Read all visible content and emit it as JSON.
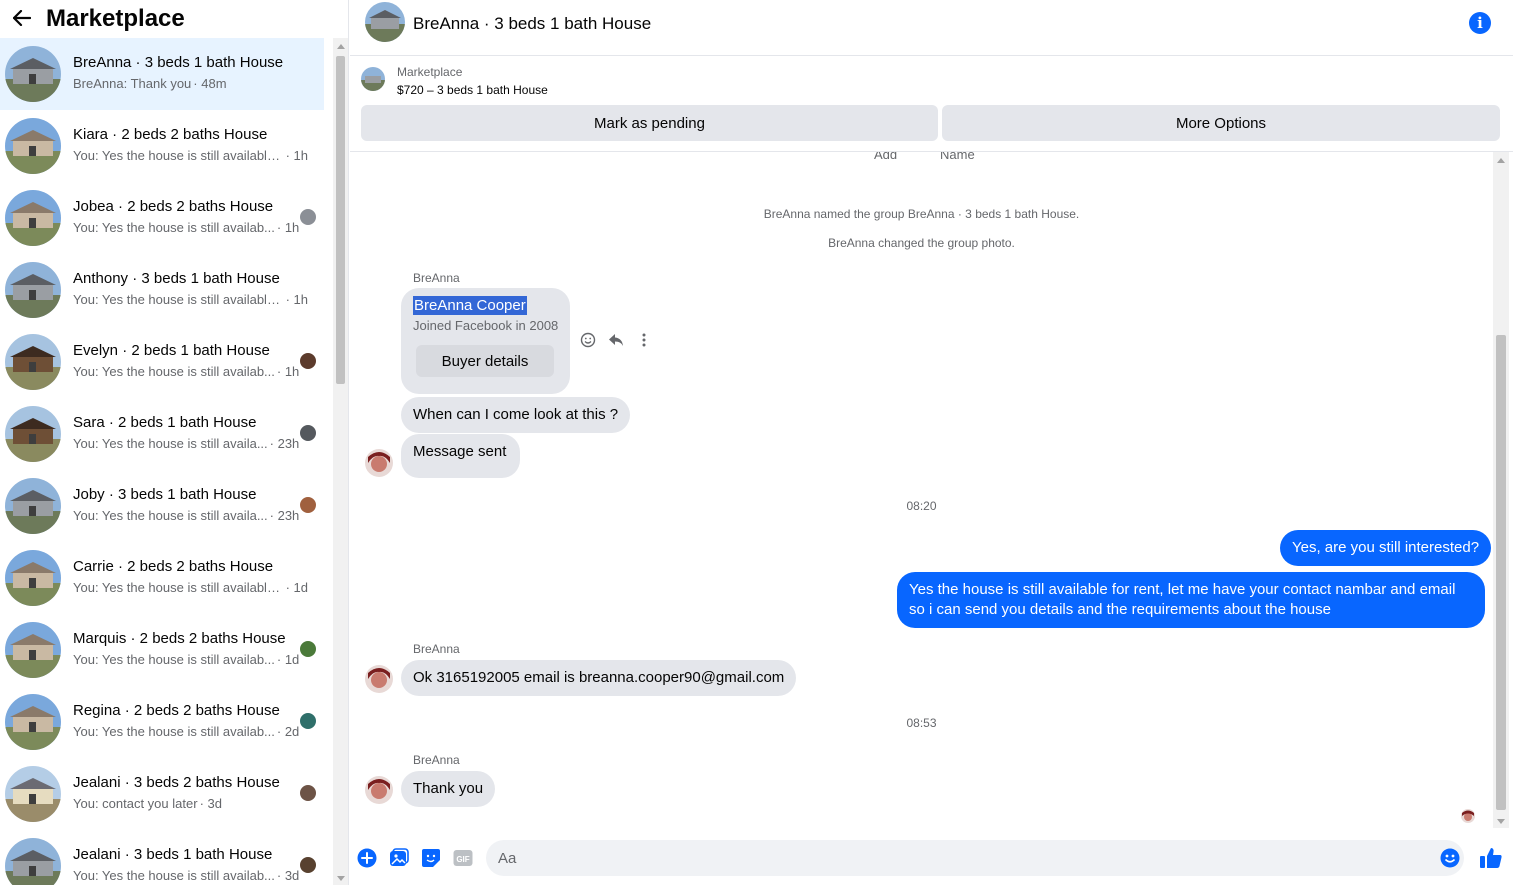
{
  "sidebar": {
    "title": "Marketplace",
    "conversations": [
      {
        "title": "BreAnna · 3 beds 1 bath House",
        "preview": "BreAnna: Thank you",
        "time": "· 48m",
        "thumb": "grey",
        "seen": ""
      },
      {
        "title": "Kiara · 2 beds 2 baths House",
        "preview": "You: Yes the house is still available f...",
        "time": "· 1h",
        "thumb": "tan",
        "seen": ""
      },
      {
        "title": "Jobea · 2 beds 2 baths House",
        "preview": "You: Yes the house is still availab...",
        "time": "· 1h",
        "thumb": "tan",
        "seen": "a"
      },
      {
        "title": "Anthony · 3 beds 1 bath House",
        "preview": "You: Yes the house is still available f...",
        "time": "· 1h",
        "thumb": "grey",
        "seen": ""
      },
      {
        "title": "Evelyn · 2 beds 1 bath House",
        "preview": "You: Yes the house is still availab...",
        "time": "· 1h",
        "thumb": "brown",
        "seen": "b"
      },
      {
        "title": "Sara · 2 beds 1 bath House",
        "preview": "You: Yes the house is still availa...",
        "time": "· 23h",
        "thumb": "brown",
        "seen": "c"
      },
      {
        "title": "Joby · 3 beds 1 bath House",
        "preview": "You: Yes the house is still availa...",
        "time": "· 23h",
        "thumb": "grey",
        "seen": "d"
      },
      {
        "title": "Carrie · 2 beds 2 baths House",
        "preview": "You: Yes the house is still available ...",
        "time": "· 1d",
        "thumb": "tan",
        "seen": ""
      },
      {
        "title": "Marquis · 2 beds 2 baths House",
        "preview": "You: Yes the house is still availab...",
        "time": "· 1d",
        "thumb": "tan",
        "seen": "e"
      },
      {
        "title": "Regina · 2 beds 2 baths House",
        "preview": "You: Yes the house is still availab...",
        "time": "· 2d",
        "thumb": "tan",
        "seen": "f"
      },
      {
        "title": "Jealani · 3 beds 2 baths House",
        "preview": "You: contact you later",
        "time": "· 3d",
        "thumb": "cream",
        "seen": "g"
      },
      {
        "title": "Jealani · 3 beds 1 bath House",
        "preview": "You: Yes the house is still availab...",
        "time": "· 3d",
        "thumb": "grey",
        "seen": "h"
      }
    ]
  },
  "chat": {
    "title": "BreAnna · 3 beds 1 bath House",
    "marketplace_label": "Marketplace",
    "listing": "$720 – 3 beds 1 bath House",
    "mark_pending": "Mark as pending",
    "more_options": "More Options",
    "partial_top_left": "Add",
    "partial_top_right": "Name",
    "system_1": "BreAnna named the group BreAnna · 3 beds 1 bath House.",
    "system_2": "BreAnna changed the group photo.",
    "sender_name": "BreAnna",
    "buyer_name": "BreAnna Cooper",
    "buyer_joined": "Joined Facebook in 2008",
    "buyer_details": "Buyer details",
    "msg_1": "When can I come look at this ?",
    "msg_2": "Message sent",
    "time_1": "08:20",
    "out_1": "Yes, are you still interested?",
    "out_2": "Yes the house is still available for rent, let me have your contact nambar and email so i can send you details and the requirements about the house",
    "msg_3": "Ok 3165192005 email is breanna.cooper90@gmail.com",
    "time_2": "08:53",
    "msg_4": "Thank you"
  },
  "composer": {
    "placeholder": "Aa",
    "gif_label": "GIF"
  },
  "colors": {
    "accent": "#0866ff",
    "active_bg": "#e7f3ff",
    "bubble_in": "#e4e6eb"
  }
}
